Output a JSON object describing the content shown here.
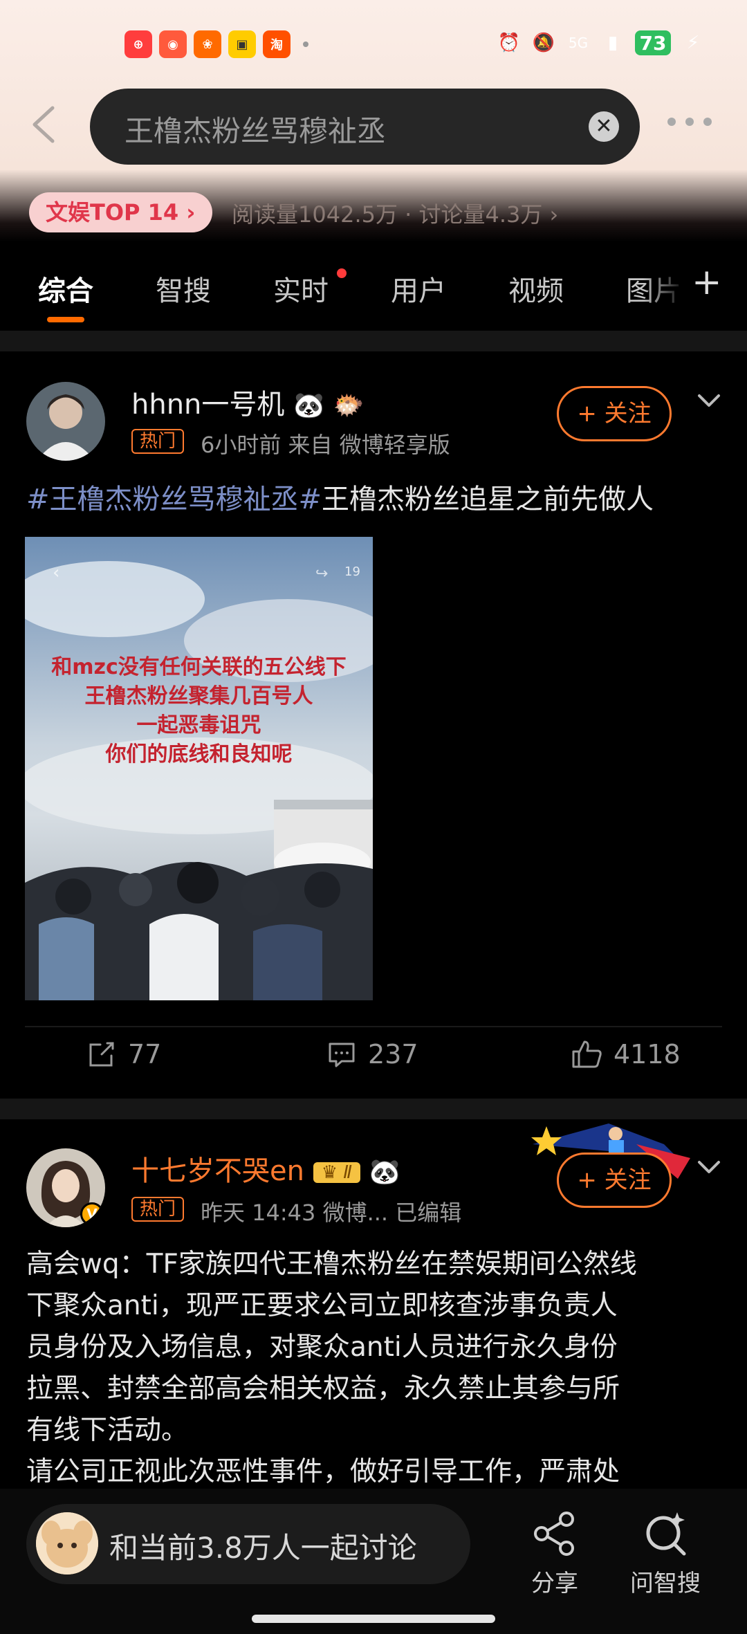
{
  "status_bar": {
    "app_icons": [
      {
        "name": "taobao-app-icon",
        "color": "#ff3d3d",
        "glyph": "⊕"
      },
      {
        "name": "weibo-app-icon",
        "color": "#ff5a3c",
        "glyph": "◉"
      },
      {
        "name": "app-icon-orange",
        "color": "#ff6a00",
        "glyph": "❀"
      },
      {
        "name": "app-icon-yellow",
        "color": "#ffcc00",
        "glyph": "▣"
      },
      {
        "name": "taobao-icon",
        "color": "#ff5000",
        "glyph": "淘"
      }
    ],
    "network": "5G",
    "battery": "73"
  },
  "search": {
    "query": "王橹杰粉丝骂穆祉丞",
    "clear_glyph": "✕"
  },
  "topic": {
    "badge": "文娱TOP 14 ›",
    "stats": "阅读量1042.5万 · 讨论量4.3万 ›"
  },
  "tabs": [
    {
      "label": "综合",
      "active": true
    },
    {
      "label": "智搜"
    },
    {
      "label": "实时"
    },
    {
      "label": "用户"
    },
    {
      "label": "视频"
    },
    {
      "label": "图片"
    }
  ],
  "tab_add": "+",
  "posts": [
    {
      "username": "hhnn一号机",
      "hot_tag": "热门",
      "meta": "6小时前   来自 微博轻享版",
      "follow": "+ 关注",
      "hashtag": "#王橹杰粉丝骂穆祉丞#",
      "text": "王橹杰粉丝追星之前先做人",
      "media_caption": [
        "和mzc没有任何关联的五公线下",
        "王橹杰粉丝聚集几百号人",
        "一起恶毒诅咒",
        "你们的底线和良知呢"
      ],
      "media_share_count": "19",
      "actions": {
        "repost": "77",
        "comment": "237",
        "like": "4118"
      }
    },
    {
      "username": "十七岁不哭en",
      "hot_tag": "热门",
      "meta": "昨天 14:43   微博...   已编辑",
      "follow": "+ 关注",
      "text_lines": [
        "高会wq：TF家族四代王橹杰粉丝在禁娱期间公然线",
        "下聚众anti，现严正要求公司立即核查涉事负责人",
        "员身份及入场信息，对聚众anti人员进行永久身份",
        "拉黑、封禁全部高会相关权益，永久禁止其参与所",
        "有线下活动。",
        "请公司正视此次恶性事件，做好引导工作，严肃处"
      ]
    }
  ],
  "bottom": {
    "discuss": "和当前3.8万人一起讨论",
    "share": "分享",
    "ask": "问智搜"
  },
  "colors": {
    "accent": "#ff7a2f",
    "hashtag": "#7d8fc8",
    "battery": "#2fbe5f"
  }
}
